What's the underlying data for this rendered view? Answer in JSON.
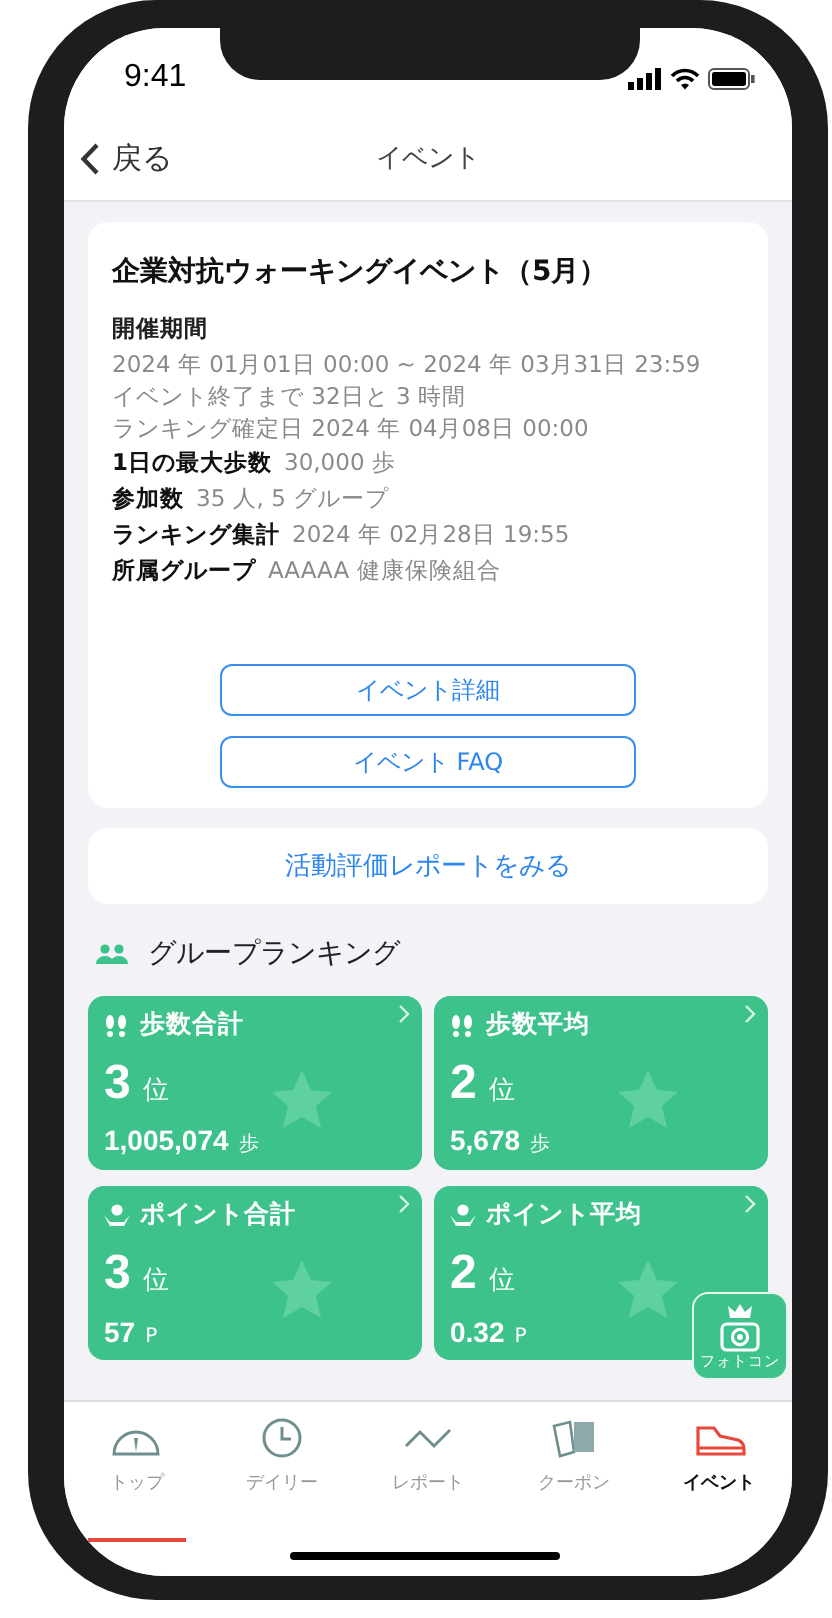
{
  "status_bar": {
    "time": "9:41"
  },
  "nav": {
    "back": "戻る",
    "title": "イベント"
  },
  "event": {
    "title": "企業対抗ウォーキングイベント（5月）",
    "period": {
      "label": "開催期間",
      "lines": [
        "2024 年 01月01日 00:00 ~ 2024 年 03月31日 23:59",
        "イベント終了まで 32日と 3 時間",
        "ランキング確定日 2024 年 04月08日 00:00"
      ]
    },
    "facts": [
      {
        "label": "1日の最大歩数",
        "value": "30,000 歩"
      },
      {
        "label": "参加数",
        "value": "35 人, 5 グループ"
      },
      {
        "label": "ランキング集計",
        "value": "2024 年 02月28日 19:55"
      },
      {
        "label": "所属グループ",
        "value": "AAAAA 健康保険組合"
      }
    ],
    "buttons": [
      "イベント詳細",
      "イベント FAQ"
    ]
  },
  "report_button": "活動評価レポートをみる",
  "ranking": {
    "title": "グループランキング",
    "tiles": [
      {
        "kind": "steps",
        "title": "歩数合計",
        "rank": "3",
        "rank_unit": "位",
        "value": "1,005,074",
        "value_unit": "歩"
      },
      {
        "kind": "steps",
        "title": "歩数平均",
        "rank": "2",
        "rank_unit": "位",
        "value": "5,678",
        "value_unit": "歩"
      },
      {
        "kind": "points",
        "title": "ポイント合計",
        "rank": "3",
        "rank_unit": "位",
        "value": "57",
        "value_unit": "P"
      },
      {
        "kind": "points",
        "title": "ポイント平均",
        "rank": "2",
        "rank_unit": "位",
        "value": "0.32",
        "value_unit": "P"
      }
    ]
  },
  "photo_contest": {
    "label": "フォトコン"
  },
  "tab_bar": [
    {
      "kind": "top",
      "label": "トップ",
      "selected": false
    },
    {
      "kind": "daily",
      "label": "デイリー",
      "selected": false
    },
    {
      "kind": "report",
      "label": "レポート",
      "selected": false
    },
    {
      "kind": "coupon",
      "label": "クーポン",
      "selected": false
    },
    {
      "kind": "event",
      "label": "イベント",
      "selected": true
    }
  ]
}
